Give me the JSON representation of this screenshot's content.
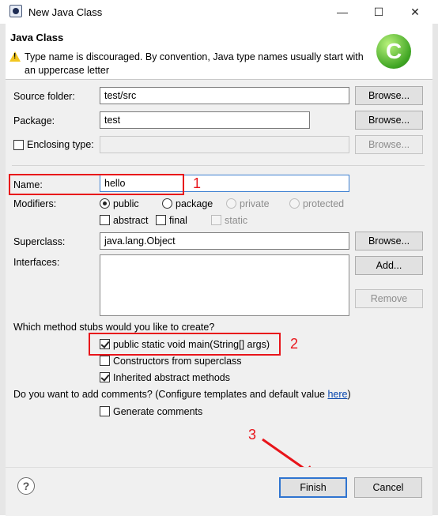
{
  "window": {
    "title": "New Java Class",
    "minimize_glyph": "—",
    "maximize_glyph": "☐",
    "close_glyph": "✕"
  },
  "header": {
    "title": "Java Class",
    "message": "Type name is discouraged. By convention, Java type names usually start with an uppercase letter",
    "message_icon": "warning-icon",
    "logo_icon": "new-class-icon"
  },
  "form": {
    "source_folder": {
      "label": "Source folder:",
      "value": "test/src",
      "button": "Browse..."
    },
    "package": {
      "label": "Package:",
      "value": "test",
      "button": "Browse..."
    },
    "enclosing_type": {
      "label": "Enclosing type:",
      "value": "",
      "button": "Browse...",
      "checked": false
    },
    "name": {
      "label": "Name:",
      "value": "hello"
    },
    "modifiers": {
      "label": "Modifiers:",
      "visibility": [
        "public",
        "package",
        "private",
        "protected"
      ],
      "selected": "public",
      "flags": [
        "abstract",
        "final",
        "static"
      ]
    },
    "superclass": {
      "label": "Superclass:",
      "value": "java.lang.Object",
      "button": "Browse..."
    },
    "interfaces": {
      "label": "Interfaces:",
      "add_button": "Add...",
      "remove_button": "Remove"
    },
    "stubs": {
      "question": "Which method stubs would you like to create?",
      "main": {
        "label": "public static void main(String[] args)",
        "checked": true
      },
      "constructors": {
        "label": "Constructors from superclass",
        "checked": false
      },
      "inherited": {
        "label": "Inherited abstract methods",
        "checked": true
      }
    },
    "comments": {
      "question": "Do you want to add comments? (Configure templates and default value ",
      "link": "here",
      "question_end": ")",
      "generate": {
        "label": "Generate comments",
        "checked": false
      }
    }
  },
  "annotations": {
    "one": "1",
    "two": "2",
    "three": "3"
  },
  "footer": {
    "help_icon": "?",
    "finish": "Finish",
    "cancel": "Cancel"
  },
  "colors": {
    "annotation": "#e8141a",
    "link": "#0645ad",
    "warning": "#f2c61f",
    "focus": "#2f74d0"
  }
}
